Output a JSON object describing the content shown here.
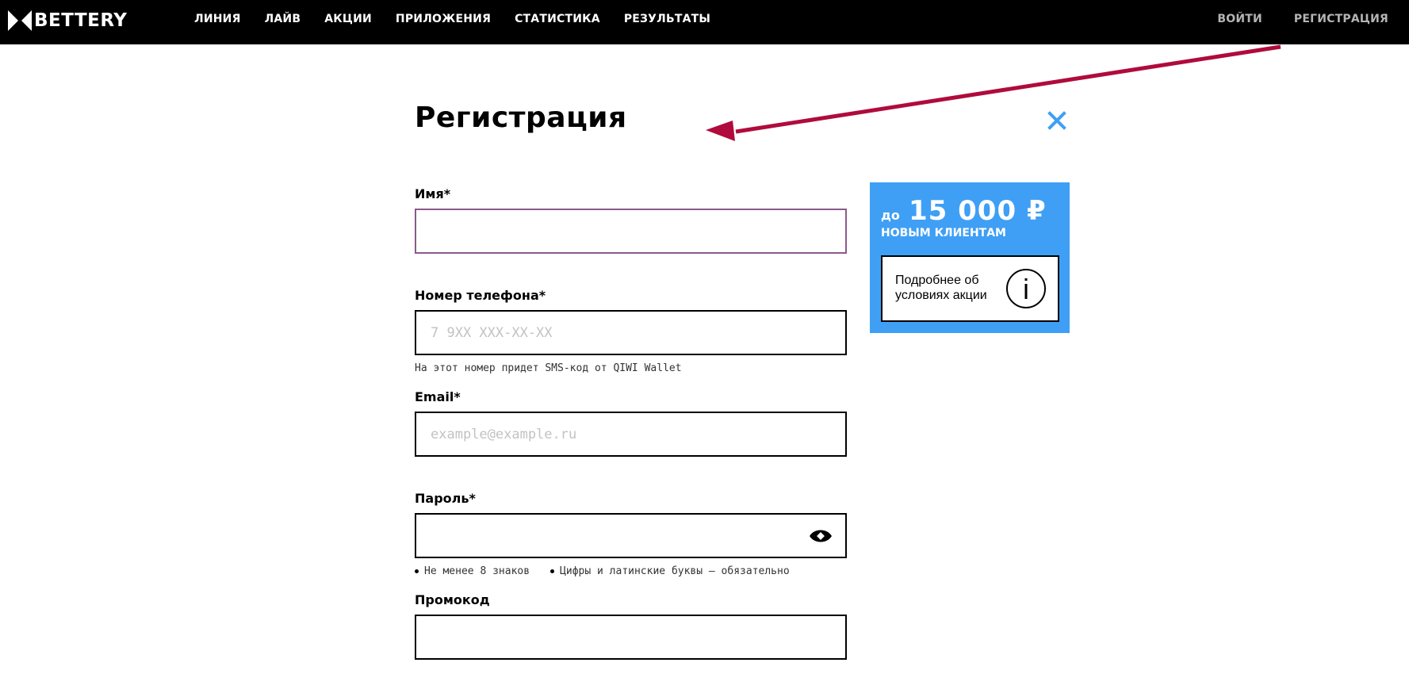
{
  "header": {
    "logo_text": "BETTERY",
    "nav": [
      {
        "label": "ЛИНИЯ"
      },
      {
        "label": "ЛАЙВ"
      },
      {
        "label": "АКЦИИ"
      },
      {
        "label": "ПРИЛОЖЕНИЯ"
      },
      {
        "label": "СТАТИСТИКА"
      },
      {
        "label": "РЕЗУЛЬТАТЫ"
      }
    ],
    "login_label": "ВОЙТИ",
    "register_label": "РЕГИСТРАЦИЯ"
  },
  "form": {
    "title": "Регистрация",
    "name": {
      "label": "Имя*",
      "placeholder": "",
      "value": ""
    },
    "phone": {
      "label": "Номер телефона*",
      "placeholder": "7 9XX XXX-XX-XX",
      "value": "",
      "hint": "На этот номер придет SMS-код от QIWI Wallet"
    },
    "email": {
      "label": "Email*",
      "placeholder": "example@example.ru",
      "value": ""
    },
    "password": {
      "label": "Пароль*",
      "value": "",
      "rules": [
        "Не менее 8 знаков",
        "Цифры и латинские буквы – обязательно"
      ]
    },
    "promo": {
      "label": "Промокод",
      "value": ""
    }
  },
  "promo_card": {
    "prefix": "до",
    "amount": "15 000 ₽",
    "subtitle": "НОВЫМ КЛИЕНТАМ",
    "details_label": "Подробнее об условиях акции",
    "background_color": "#3f9ff5"
  },
  "icons": {
    "close": "close-icon",
    "eye": "eye-icon",
    "info": "info-icon",
    "logo_mark": "bettery-logo-icon"
  },
  "colors": {
    "close_icon": "#3f9ff5",
    "annotation_arrow": "#b00b3c",
    "focused_border": "#8b5a8c"
  }
}
